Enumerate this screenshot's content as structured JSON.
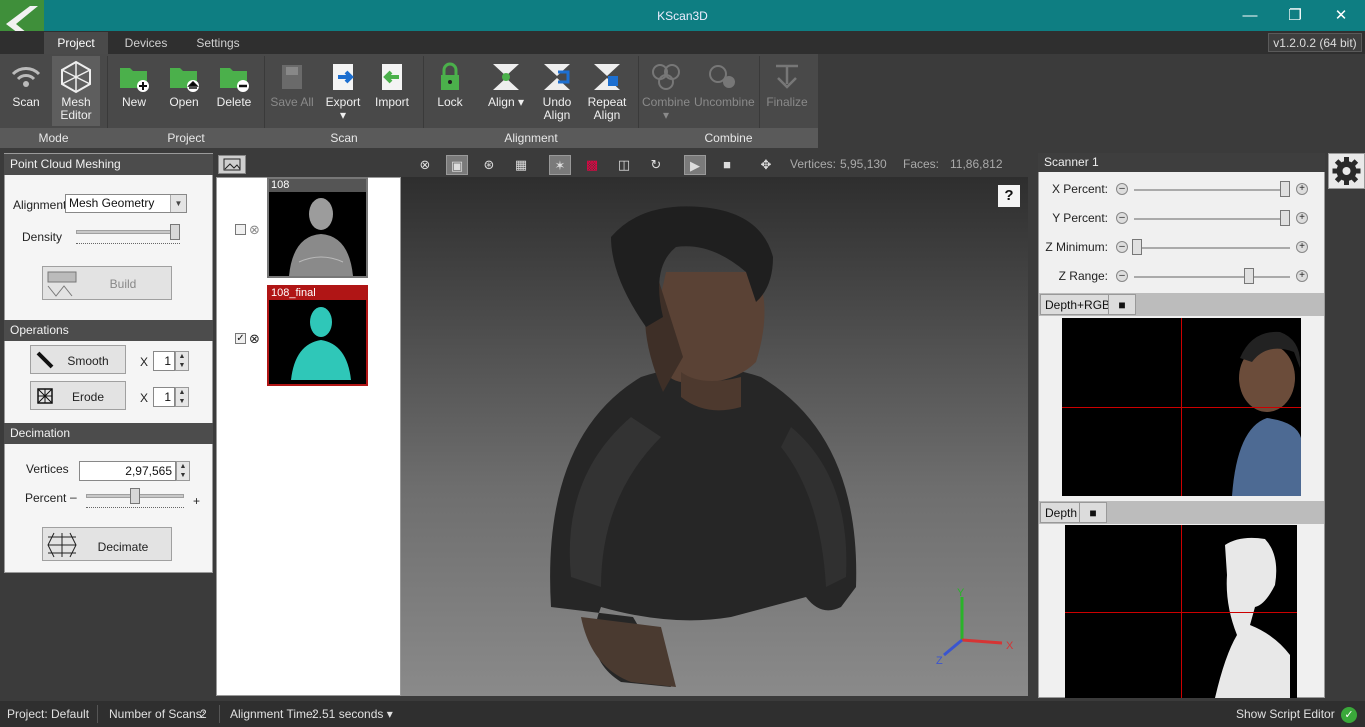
{
  "window": {
    "title": "KScan3D",
    "version": "v1.2.0.2  (64 bit)",
    "controls": {
      "minimize": "—",
      "maximize": "❐",
      "close": "✕"
    }
  },
  "tabs": [
    {
      "label": "Project",
      "active": true
    },
    {
      "label": "Devices",
      "active": false
    },
    {
      "label": "Settings",
      "active": false
    }
  ],
  "ribbon": {
    "groups": [
      "Mode",
      "Project",
      "Scan",
      "Alignment",
      "Combine"
    ],
    "buttons": {
      "scan": "Scan",
      "mesh_editor_1": "Mesh",
      "mesh_editor_2": "Editor",
      "new": "New",
      "open": "Open",
      "delete": "Delete",
      "save_all": "Save All",
      "export": "Export",
      "import": "Import",
      "lock": "Lock",
      "align": "Align ▾",
      "undo_align_1": "Undo",
      "undo_align_2": "Align",
      "repeat_align_1": "Repeat",
      "repeat_align_2": "Align",
      "combine": "Combine",
      "uncombine": "Uncombine",
      "finalize": "Finalize"
    }
  },
  "left_panel": {
    "point_cloud": {
      "header": "Point Cloud Meshing",
      "alignment_label": "Alignment",
      "alignment_value": "Mesh Geometry",
      "density_label": "Density",
      "density_level": 0.95,
      "build_label": "Build"
    },
    "operations": {
      "header": "Operations",
      "smooth_label": "Smooth",
      "smooth_times_label": "X",
      "smooth_times": "1",
      "erode_label": "Erode",
      "erode_times_label": "X",
      "erode_times": "1"
    },
    "decimation": {
      "header": "Decimation",
      "vertices_label": "Vertices",
      "vertices_value": "2,97,565",
      "percent_label": "Percent",
      "minus": "–",
      "plus": "+",
      "percent_level": 0.5,
      "decimate_label": "Decimate"
    }
  },
  "scans": [
    {
      "name": "108",
      "checked": false,
      "selected": false
    },
    {
      "name": "108_final",
      "checked": true,
      "selected": true
    }
  ],
  "viewport": {
    "vertices_label": "Vertices:",
    "vertices_value": "5,95,130",
    "faces_label": "Faces:",
    "faces_value": "11,86,812",
    "help": "?",
    "axis_x": "X",
    "axis_y": "Y",
    "axis_z": "Z"
  },
  "scanner_panel": {
    "header": "Scanner 1",
    "sliders": [
      {
        "label": "X Percent:",
        "level": 0.97
      },
      {
        "label": "Y Percent:",
        "level": 0.97
      },
      {
        "label": "Z Minimum:",
        "level": 0.02
      },
      {
        "label": "Z Range:",
        "level": 0.74
      }
    ],
    "minus": "–",
    "plus": "+",
    "view1_tab": "Depth+RGB",
    "view2_tab": "Depth"
  },
  "status": {
    "project_label": "Project:",
    "project_value": "Default",
    "scans_label": "Number of Scans:",
    "scans_value": "2",
    "align_time_label": "Alignment Time:",
    "align_time_value": "2.51 seconds ▾",
    "script_editor": "Show Script Editor"
  },
  "colors": {
    "titlebar": "#0e7e82",
    "selected_scan_border": "#b01515",
    "mesh_final": "#2fc7b8"
  }
}
